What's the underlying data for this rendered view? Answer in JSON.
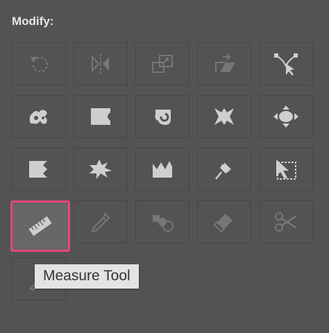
{
  "panel": {
    "title": "Modify:",
    "tools": [
      {
        "name": "rotate-icon"
      },
      {
        "name": "reflect-icon"
      },
      {
        "name": "scale-icon"
      },
      {
        "name": "shear-icon"
      },
      {
        "name": "reshape-icon"
      },
      {
        "name": "twirl-icon"
      },
      {
        "name": "pucker-icon"
      },
      {
        "name": "bloat-icon"
      },
      {
        "name": "scallop-icon"
      },
      {
        "name": "crystallize-icon"
      },
      {
        "name": "wrinkle-icon"
      },
      {
        "name": "puppet-warp-icon"
      },
      {
        "name": "free-transform-icon"
      },
      {
        "name": "width-tool-icon"
      },
      {
        "name": "warp-icon"
      },
      {
        "name": "measure-icon",
        "selected": true
      },
      {
        "name": "eyedropper-icon"
      },
      {
        "name": "shape-builder-icon"
      },
      {
        "name": "eraser-icon"
      },
      {
        "name": "scissors-icon"
      },
      {
        "name": "knife-icon"
      }
    ]
  },
  "tooltip": {
    "text": "Measure Tool"
  },
  "colors": {
    "panel_bg": "#535353",
    "icon": "#cfcfcf",
    "icon_dim": "#777777",
    "selection_border": "#e8457a",
    "tooltip_bg": "#e3e3e3"
  }
}
